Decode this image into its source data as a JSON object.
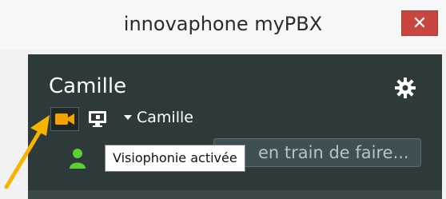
{
  "window": {
    "title": "innovaphone myPBX",
    "close_label": "✕"
  },
  "user": {
    "name": "Camille"
  },
  "toolbar": {
    "device_name": "Camille"
  },
  "status": {
    "placeholder": "en train de faire..."
  },
  "tooltip": {
    "text": "Visiophonie activée"
  },
  "colors": {
    "accent_video": "#f3a200",
    "presence_green": "#5bd12f",
    "annotation_arrow": "#f5b400"
  }
}
